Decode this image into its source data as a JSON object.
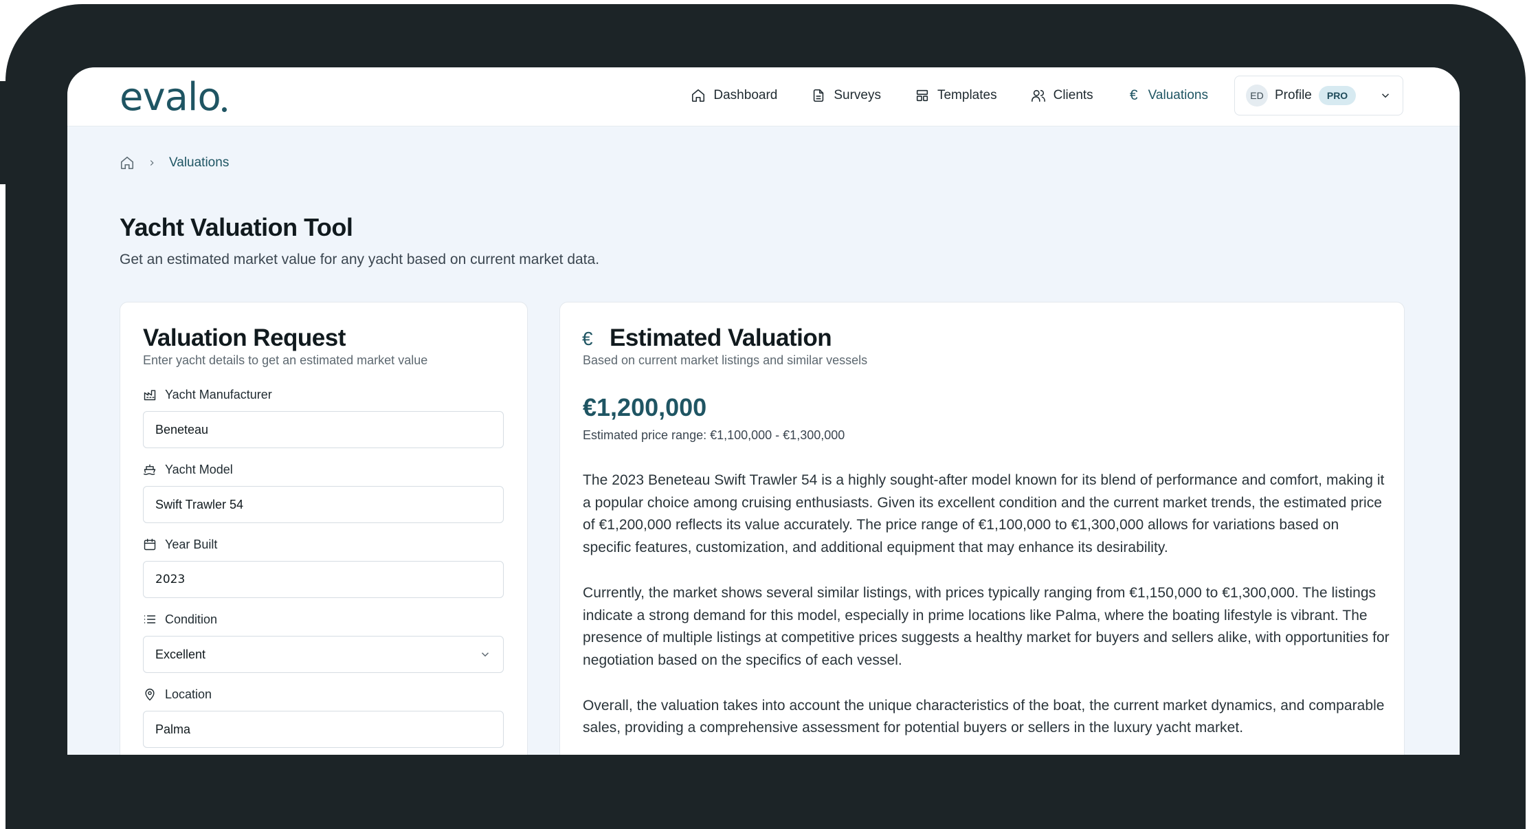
{
  "brand": {
    "logo": "evalo"
  },
  "nav": {
    "items": [
      {
        "label": "Dashboard",
        "icon": "home-icon"
      },
      {
        "label": "Surveys",
        "icon": "document-icon"
      },
      {
        "label": "Templates",
        "icon": "layout-icon"
      },
      {
        "label": "Clients",
        "icon": "users-icon"
      },
      {
        "label": "Valuations",
        "icon": "euro-icon",
        "active": true
      }
    ],
    "profile": {
      "initials": "ED",
      "label": "Profile",
      "badge": "PRO"
    }
  },
  "breadcrumb": {
    "current": "Valuations"
  },
  "page": {
    "title": "Yacht Valuation Tool",
    "subtitle": "Get an estimated market value for any yacht based on current market data."
  },
  "request": {
    "title": "Valuation Request",
    "description": "Enter yacht details to get an estimated market value",
    "fields": {
      "manufacturer": {
        "label": "Yacht Manufacturer",
        "value": "Beneteau"
      },
      "model": {
        "label": "Yacht Model",
        "value": "Swift Trawler 54"
      },
      "year": {
        "label": "Year Built",
        "value": "2023"
      },
      "condition": {
        "label": "Condition",
        "value": "Excellent"
      },
      "location": {
        "label": "Location",
        "value": "Palma"
      }
    }
  },
  "result": {
    "title": "Estimated Valuation",
    "description": "Based on current market listings and similar vessels",
    "price": "€1,200,000",
    "range": "Estimated price range: €1,100,000 - €1,300,000",
    "paragraphs": [
      "The 2023 Beneteau Swift Trawler 54 is a highly sought-after model known for its blend of performance and comfort, making it a popular choice among cruising enthusiasts. Given its excellent condition and the current market trends, the estimated price of €1,200,000 reflects its value accurately. The price range of €1,100,000 to €1,300,000 allows for variations based on specific features, customization, and additional equipment that may enhance its desirability.",
      "Currently, the market shows several similar listings, with prices typically ranging from €1,150,000 to €1,300,000. The listings indicate a strong demand for this model, especially in prime locations like Palma, where the boating lifestyle is vibrant. The presence of multiple listings at competitive prices suggests a healthy market for buyers and sellers alike, with opportunities for negotiation based on the specifics of each vessel.",
      "Overall, the valuation takes into account the unique characteristics of the boat, the current market dynamics, and comparable sales, providing a comprehensive assessment for potential buyers or sellers in the luxury yacht market."
    ]
  },
  "colors": {
    "accent": "#1f5563",
    "background": "#f0f5fb",
    "frame": "#1c2427"
  }
}
